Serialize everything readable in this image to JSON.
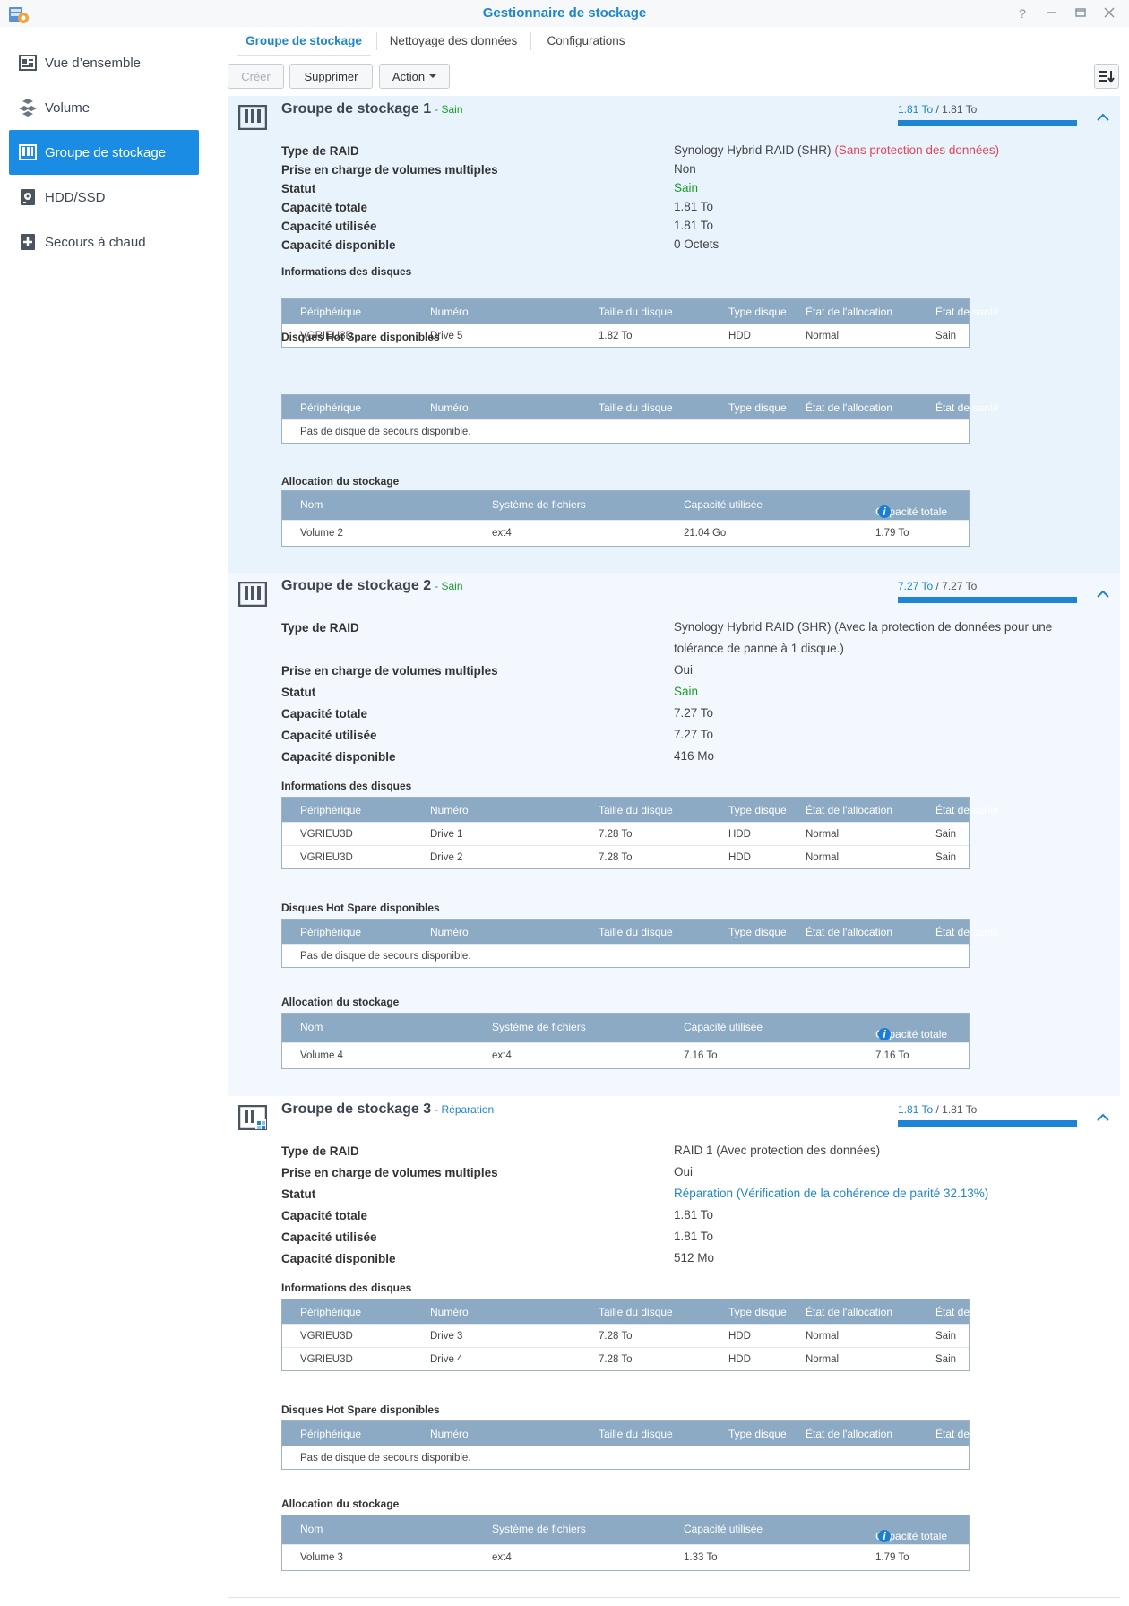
{
  "window": {
    "title": "Gestionnaire de stockage",
    "icons": [
      "help-icon",
      "minimize-icon",
      "maximize-icon",
      "close-icon"
    ]
  },
  "sidebar": {
    "items": [
      {
        "label": "Vue d’ensemble",
        "icon": "overview-icon",
        "active": false
      },
      {
        "label": "Volume",
        "icon": "volume-icon",
        "active": false
      },
      {
        "label": "Groupe de stockage",
        "icon": "storage-pool-icon",
        "active": true
      },
      {
        "label": "HDD/SSD",
        "icon": "disk-icon",
        "active": false
      },
      {
        "label": "Secours à chaud",
        "icon": "hot-spare-icon",
        "active": false
      }
    ]
  },
  "tabs": [
    {
      "label": "Groupe de stockage",
      "active": true
    },
    {
      "label": "Nettoyage des données",
      "active": false
    },
    {
      "label": "Configurations",
      "active": false
    }
  ],
  "toolbar": {
    "create": "Créer",
    "delete": "Supprimer",
    "action": "Action"
  },
  "labels": {
    "raid_type": "Type de RAID",
    "multi_volume": "Prise en charge de volumes multiples",
    "status": "Statut",
    "total": "Capacité totale",
    "used": "Capacité utilisée",
    "available": "Capacité disponible",
    "disk_info": "Informations des disques",
    "hot_spare": "Disques Hot Spare disponibles",
    "allocation": "Allocation du stockage",
    "col_device": "Périphérique",
    "col_number": "Numéro",
    "col_size": "Taille du disque",
    "col_type": "Type disque",
    "col_alloc": "État de l'allocation",
    "col_health": "État de santé",
    "col_name": "Nom",
    "col_fs": "Système de fichiers",
    "col_used": "Capacité utilisée",
    "col_total": "Capacité totale",
    "no_spare": "Pas de disque de secours disponible.",
    "cap_sep": " / "
  },
  "pools": [
    {
      "title": "Groupe de stockage 1",
      "status_inline": "- Sain",
      "cap_used": "1.81 To",
      "cap_total": "1.81 To",
      "usage_fraction": 1.0,
      "raid_type": "Synology Hybrid RAID (SHR)",
      "raid_note": "(Sans protection des données)",
      "multi_volume": "Non",
      "status": "Sain",
      "status_note": "",
      "total": "1.81 To",
      "used": "1.81 To",
      "available": "0 Octets",
      "disks": [
        {
          "device": "VGRIEU3D",
          "number": "Drive 5",
          "size": "1.82 To",
          "type": "HDD",
          "alloc": "Normal",
          "health": "Sain"
        }
      ],
      "volumes": [
        {
          "name": "Volume 2",
          "fs": "ext4",
          "used": "21.04 Go",
          "total": "1.79 To"
        }
      ]
    },
    {
      "title": "Groupe de stockage 2",
      "status_inline": "- Sain",
      "cap_used": "7.27 To",
      "cap_total": "7.27 To",
      "usage_fraction": 1.0,
      "raid_type": "Synology Hybrid RAID (SHR) (Avec la protection de données pour une tolérance de panne à 1 disque.)",
      "raid_note": "",
      "multi_volume": "Oui",
      "status": "Sain",
      "status_note": "",
      "total": "7.27 To",
      "used": "7.27 To",
      "available": "416 Mo",
      "disks": [
        {
          "device": "VGRIEU3D",
          "number": "Drive 1",
          "size": "7.28 To",
          "type": "HDD",
          "alloc": "Normal",
          "health": "Sain"
        },
        {
          "device": "VGRIEU3D",
          "number": "Drive 2",
          "size": "7.28 To",
          "type": "HDD",
          "alloc": "Normal",
          "health": "Sain"
        }
      ],
      "volumes": [
        {
          "name": "Volume 4",
          "fs": "ext4",
          "used": "7.16 To",
          "total": "7.16 To"
        }
      ]
    },
    {
      "title": "Groupe de stockage 3",
      "status_inline": "- Réparation",
      "cap_used": "1.81 To",
      "cap_total": "1.81 To",
      "usage_fraction": 1.0,
      "raid_type": "RAID 1 (Avec protection des données)",
      "raid_note": "",
      "multi_volume": "Oui",
      "status": "Réparation",
      "status_note": "(Vérification de la cohérence de parité 32.13%)",
      "total": "1.81 To",
      "used": "1.81 To",
      "available": "512 Mo",
      "disks": [
        {
          "device": "VGRIEU3D",
          "number": "Drive 3",
          "size": "7.28 To",
          "type": "HDD",
          "alloc": "Normal",
          "health": "Sain"
        },
        {
          "device": "VGRIEU3D",
          "number": "Drive 4",
          "size": "7.28 To",
          "type": "HDD",
          "alloc": "Normal",
          "health": "Sain"
        }
      ],
      "volumes": [
        {
          "name": "Volume 3",
          "fs": "ext4",
          "used": "1.33 To",
          "total": "1.79 To"
        }
      ]
    }
  ],
  "colors": {
    "accent": "#1f86c8",
    "active_nav": "#1a8ce3",
    "healthy": "#1d9c2a",
    "warning": "#e0475a",
    "grid_header": "#8caac4"
  }
}
